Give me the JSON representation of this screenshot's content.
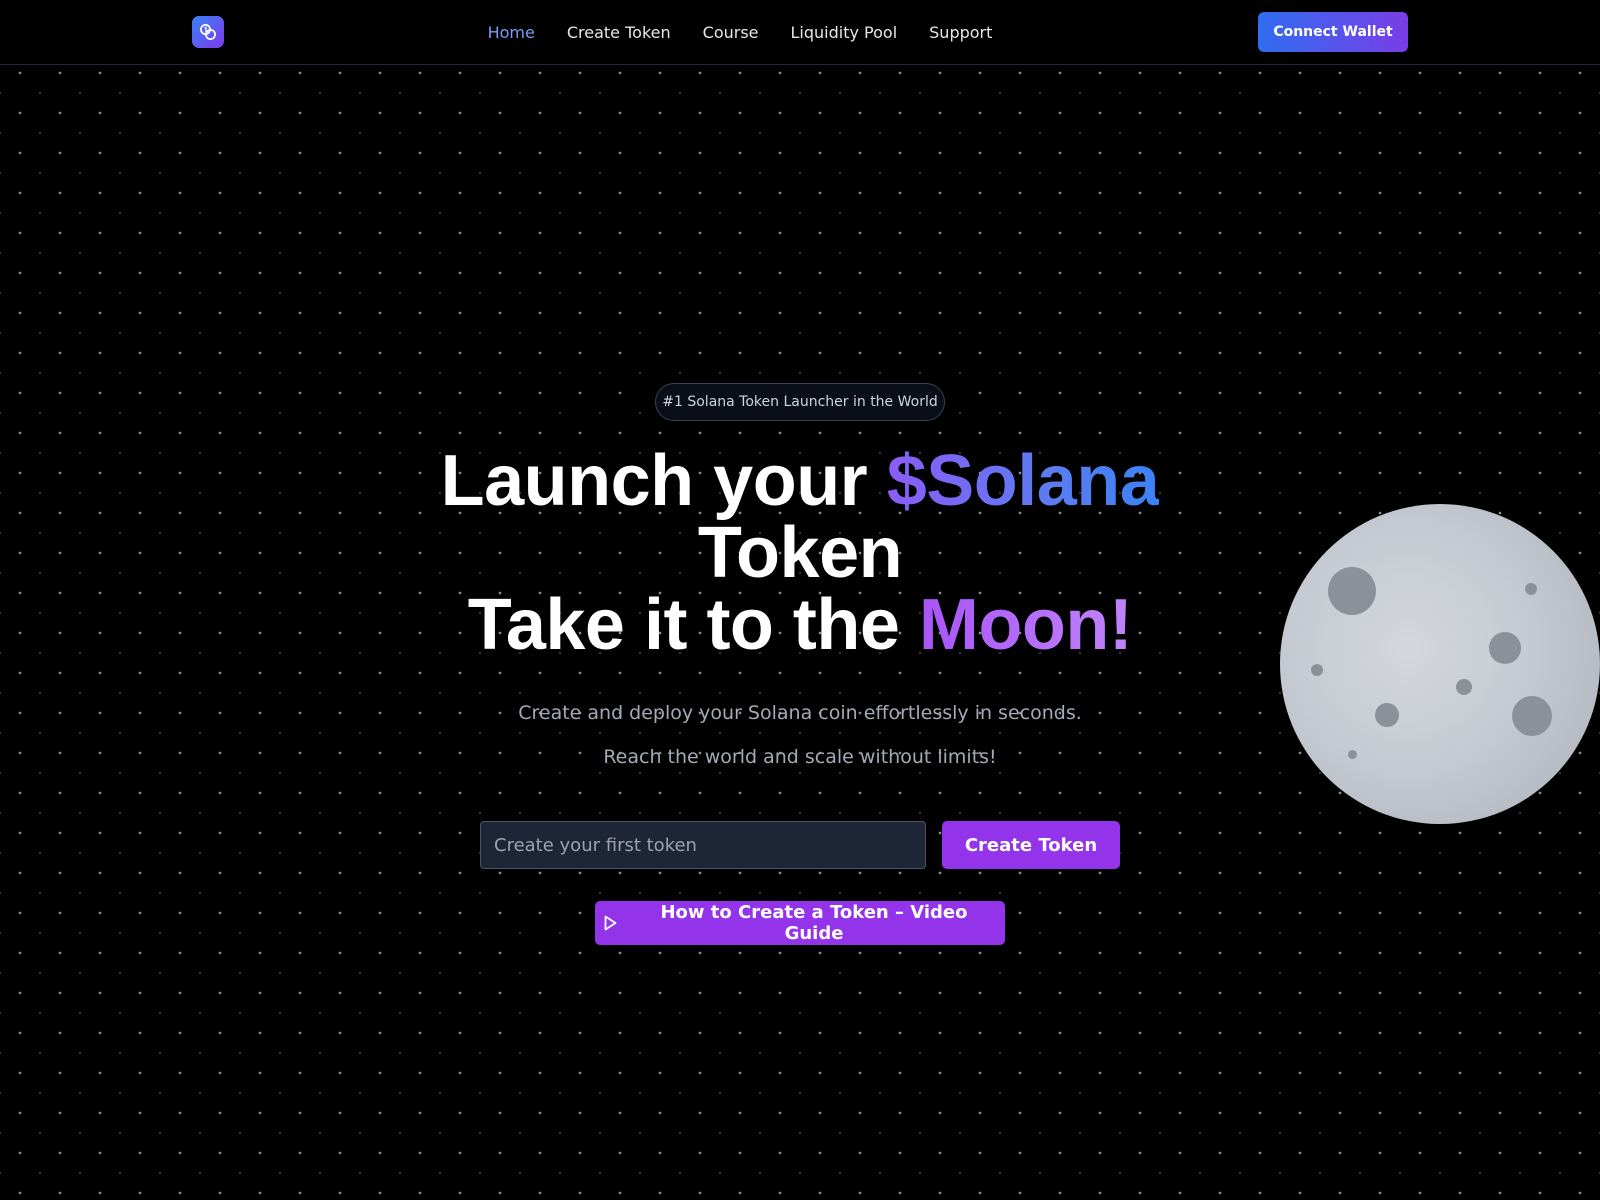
{
  "app": {
    "logo_icon": "coins-icon",
    "colors": {
      "background": "#000000",
      "accent_purple": "#9333ea",
      "accent_blue": "#3b82f6",
      "nav_active": "#7c9cf7"
    }
  },
  "nav": {
    "items": [
      {
        "label": "Home",
        "active": true
      },
      {
        "label": "Create Token",
        "active": false
      },
      {
        "label": "Course",
        "active": false
      },
      {
        "label": "Liquidity Pool",
        "active": false
      },
      {
        "label": "Support",
        "active": false
      }
    ],
    "connect_wallet_label": "Connect Wallet"
  },
  "hero": {
    "badge": "#1 Solana Token Launcher in the World",
    "headline": {
      "line1_prefix": "Launch your ",
      "line1_highlight": "$Solana",
      "line2": "Token",
      "line3_prefix": "Take it to the ",
      "line3_highlight": "Moon!"
    },
    "subtitle_1": "Create and deploy your Solana coin effortlessly in seconds.",
    "subtitle_2": "Reach the world and scale without limits!",
    "input": {
      "placeholder": "Create your first token",
      "value": ""
    },
    "create_button_label": "Create Token",
    "video_button_label": "How to Create a Token – Video Guide",
    "video_button_icon": "play-icon"
  },
  "decor": {
    "moon_icon": "moon-illustration"
  }
}
